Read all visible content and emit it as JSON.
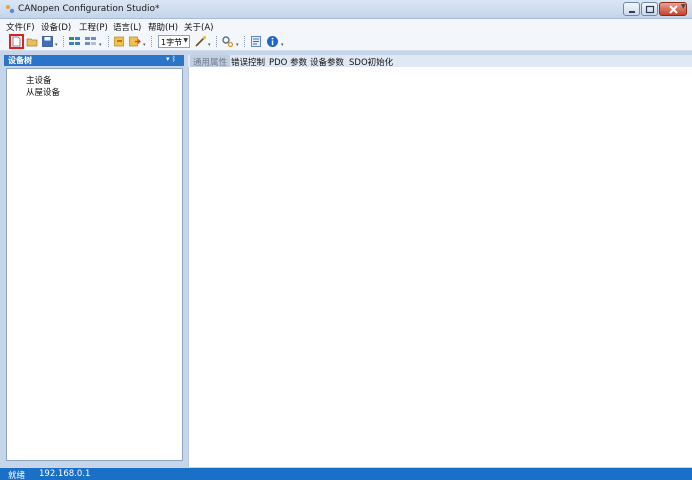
{
  "window": {
    "title": "CANopen Configuration Studio*"
  },
  "menu": [
    {
      "label": "文件(F)"
    },
    {
      "label": "设备(D)"
    },
    {
      "label": "工程(P)"
    },
    {
      "label": "语言(L)"
    },
    {
      "label": "帮助(H)"
    },
    {
      "label": "关于(A)"
    }
  ],
  "toolbar": {
    "byte_combo_value": "1字节",
    "icons": [
      "new-file-icon",
      "open-folder-icon",
      "save-icon",
      "add-node-icon",
      "remove-node-icon",
      "import-icon",
      "export-icon",
      "wand-icon",
      "settings-gears-icon",
      "config-icon",
      "info-icon"
    ]
  },
  "device_tree": {
    "header": "设备树",
    "pin_glyph": "▾ ᛒ",
    "items": [
      {
        "label": "主设备"
      },
      {
        "label": "从屋设备"
      }
    ]
  },
  "tabs": [
    {
      "label": "通用属性",
      "active": true
    },
    {
      "label": "错误控制",
      "active": false
    },
    {
      "label": "PDO 参数",
      "active": false
    },
    {
      "label": "设备参数",
      "active": false
    },
    {
      "label": "SDO初始化",
      "active": false
    }
  ],
  "status": {
    "state": "就绪",
    "ip": "192.168.0.1"
  },
  "colors": {
    "accent": "#1a6fc6",
    "dock_header": "#2a75c8",
    "selection_outline": "#e02020"
  }
}
